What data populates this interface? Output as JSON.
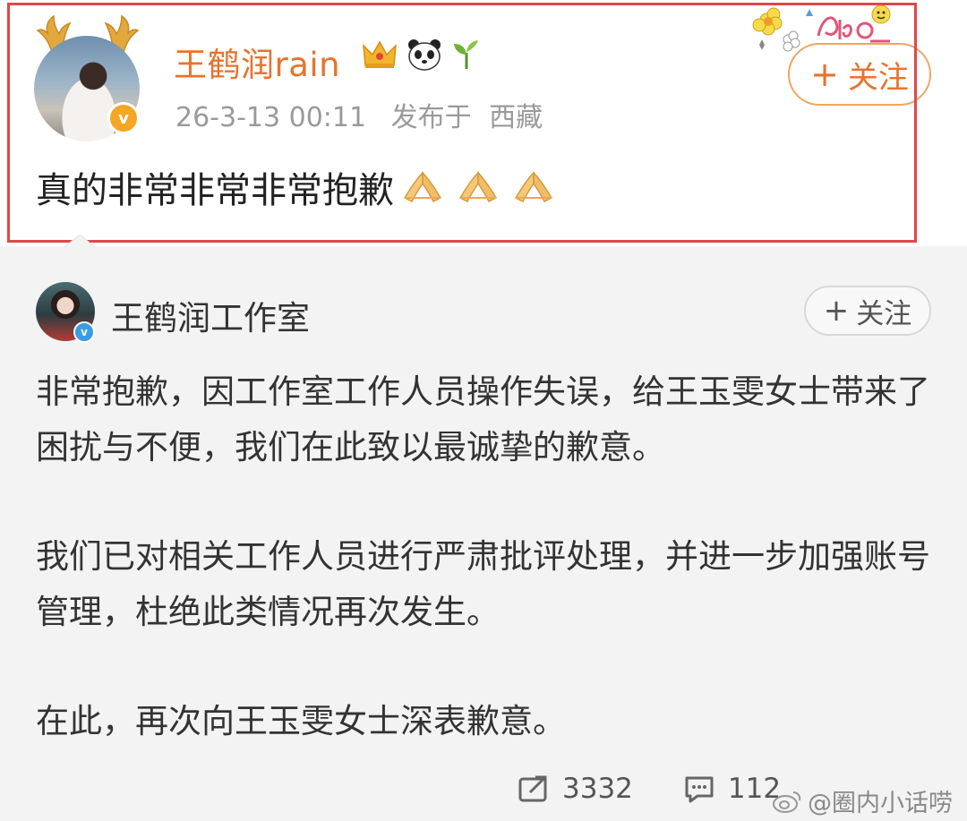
{
  "post": {
    "username": "王鹤润rain",
    "badges": [
      "crown-icon",
      "panda-icon",
      "sprout-icon"
    ],
    "timestamp": "26-3-13 00:11",
    "published_from_label": "发布于",
    "location": "西藏",
    "text": "真的非常非常非常抱歉",
    "emoji": [
      "pray-hands-icon",
      "pray-hands-icon",
      "pray-hands-icon"
    ],
    "follow_label": "关注",
    "follow_plus": "+"
  },
  "repost": {
    "author": "王鹤润工作室",
    "follow_label": "关注",
    "follow_plus": "+",
    "paragraphs": [
      "非常抱歉，因工作室工作人员操作失误，给王玉雯女士带来了困扰与不便，我们在此致以最诚挚的歉意。",
      "我们已对相关工作人员进行严肃批评处理，并进一步加强账号管理，杜绝此类情况再次发生。",
      "在此，再次向王玉雯女士深表歉意。"
    ],
    "stats": {
      "reposts": "3332",
      "comments": "112"
    }
  },
  "watermark": "@圈内小话唠",
  "colors": {
    "highlight": "#e0474c",
    "username": "#e8732c",
    "repost_bg": "#f3f3f3"
  }
}
